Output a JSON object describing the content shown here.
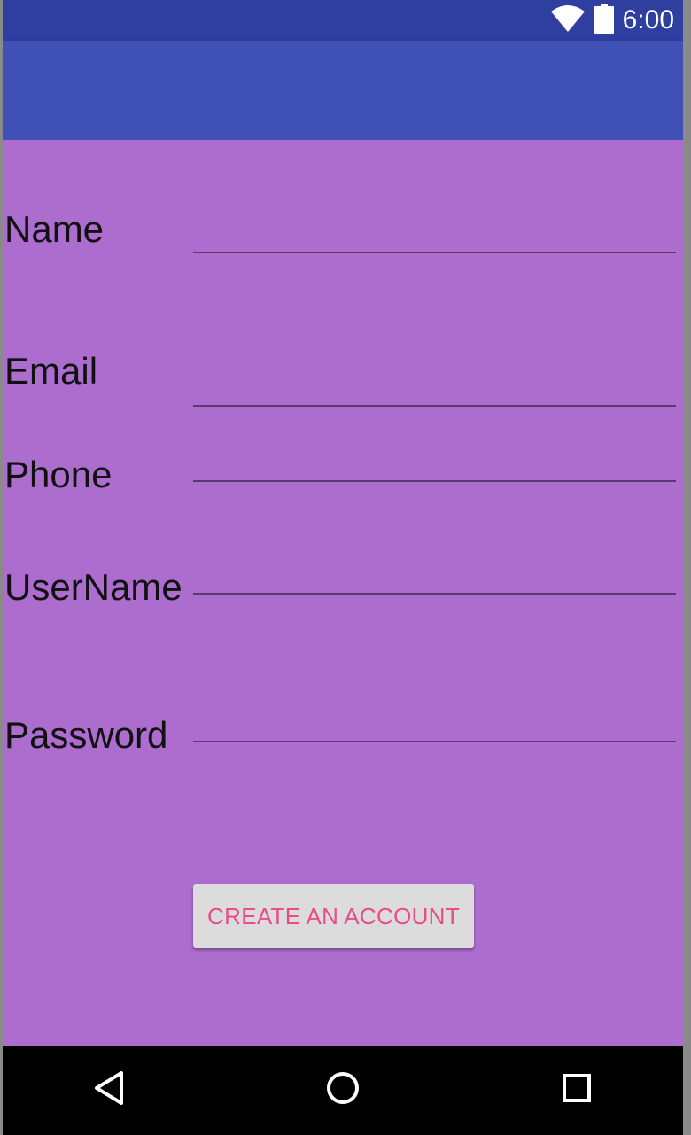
{
  "status_bar": {
    "time": "6:00",
    "icons": [
      "wifi-icon",
      "battery-icon"
    ]
  },
  "form": {
    "fields": [
      {
        "label": "Name",
        "value": "",
        "placeholder": ""
      },
      {
        "label": "Email",
        "value": "",
        "placeholder": ""
      },
      {
        "label": "Phone",
        "value": "",
        "placeholder": ""
      },
      {
        "label": "UserName",
        "value": "",
        "placeholder": ""
      },
      {
        "label": "Password",
        "value": "",
        "placeholder": ""
      }
    ],
    "submit_label": "CREATE AN ACCOUNT"
  },
  "nav_bar": {
    "icons": [
      "back-icon",
      "home-icon",
      "recents-icon"
    ]
  },
  "colors": {
    "status_bar": "#2f3fa0",
    "app_bar": "#3f51b5",
    "background": "#ad6dcf",
    "button_text": "#ea4c89",
    "button_bg": "#dcdcdc"
  }
}
